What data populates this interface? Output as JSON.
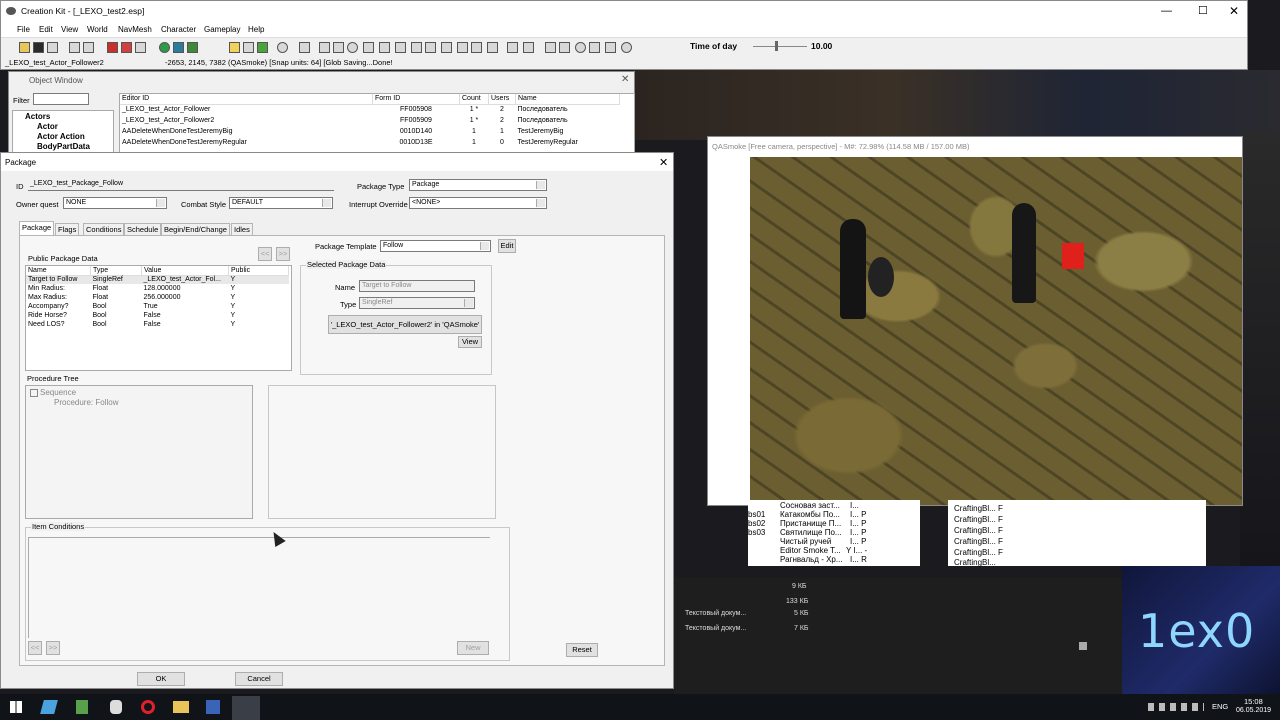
{
  "main_window": {
    "title": "Creation Kit - [_LEXO_test2.esp]",
    "menu": [
      "File",
      "Edit",
      "View",
      "World",
      "NavMesh",
      "Character",
      "Gameplay",
      "Help"
    ],
    "time_of_day_label": "Time of day",
    "time_of_day_value": "10.00",
    "time_of_day_slider": 0.42,
    "status_left": "_LEXO_test_Actor_Follower2",
    "status_right": "-2653, 2145, 7382 (QASmoke) [Snap units: 64] [Glob Saving...Done!"
  },
  "object_window": {
    "title": "Object Window",
    "filter_label": "Filter",
    "tree": [
      "Actors",
      "Actor",
      "Actor Action",
      "BodyPartData"
    ],
    "columns": [
      "Editor ID",
      "Form ID",
      "Count",
      "Users",
      "Name"
    ],
    "rows": [
      {
        "editor_id": "_LEXO_test_Actor_Follower",
        "form_id": "FF005908",
        "count": "1 *",
        "users": "2",
        "name": "Последователь"
      },
      {
        "editor_id": "_LEXO_test_Actor_Follower2",
        "form_id": "FF005909",
        "count": "1 *",
        "users": "2",
        "name": "Последователь"
      },
      {
        "editor_id": "AADeleteWhenDoneTestJeremyBig",
        "form_id": "0010D140",
        "count": "1",
        "users": "1",
        "name": "TestJeremyBig"
      },
      {
        "editor_id": "AADeleteWhenDoneTestJeremyRegular",
        "form_id": "0010D13E",
        "count": "1",
        "users": "0",
        "name": "TestJeremyRegular"
      }
    ]
  },
  "render_window": {
    "title": "QASmoke [Free camera, perspective] - M#: 72.98% (114.58 MB / 157.00 MB)"
  },
  "package_dialog": {
    "title": "Package",
    "id_label": "ID",
    "id_value": "_LEXO_test_Package_Follow",
    "package_type_label": "Package Type",
    "package_type_value": "Package",
    "owner_quest_label": "Owner quest",
    "owner_quest_value": "NONE",
    "combat_style_label": "Combat Style",
    "combat_style_value": "DEFAULT",
    "interrupt_override_label": "Interrupt Override",
    "interrupt_override_value": "<NONE>",
    "tabs": [
      "Package",
      "Flags",
      "Conditions",
      "Schedule",
      "Begin/End/Change",
      "Idles"
    ],
    "public_data_label": "Public Package Data",
    "prev_btn": "<<",
    "next_btn": ">>",
    "data_columns": [
      "Name",
      "Type",
      "Value",
      "Public"
    ],
    "data_rows": [
      {
        "name": "Target to Follow",
        "type": "SingleRef",
        "value": "_LEXO_test_Actor_Fol...",
        "public": "Y"
      },
      {
        "name": "Min Radius:",
        "type": "Float",
        "value": "128.000000",
        "public": "Y"
      },
      {
        "name": "Max Radius:",
        "type": "Float",
        "value": "256.000000",
        "public": "Y"
      },
      {
        "name": "Accompany?",
        "type": "Bool",
        "value": "True",
        "public": "Y"
      },
      {
        "name": "Ride Horse?",
        "type": "Bool",
        "value": "False",
        "public": "Y"
      },
      {
        "name": "Need LOS?",
        "type": "Bool",
        "value": "False",
        "public": "Y"
      }
    ],
    "package_template_label": "Package Template",
    "package_template_value": "Follow",
    "edit_btn": "Edit",
    "selected_group_label": "Selected Package Data",
    "sel_name_label": "Name",
    "sel_name_value": "Target to Follow",
    "sel_type_label": "Type",
    "sel_type_value": "SingleRef",
    "sel_ref_value": "'_LEXO_test_Actor_Follower2' in 'QASmoke'",
    "view_btn": "View",
    "procedure_tree_label": "Procedure Tree",
    "procedure_tree": [
      "Sequence",
      "Procedure: Follow"
    ],
    "item_conditions_label": "Item Conditions",
    "new_btn": "New",
    "reset_btn": "Reset",
    "ok_btn": "OK",
    "cancel_btn": "Cancel"
  },
  "bg_list": {
    "left_rows": [
      "Сосновая заст...",
      "Катакомбы По...",
      "Пристанище П...",
      "Святилище По...",
      "Чистый ручей",
      "Editor Smoke T...",
      "Рагнвальд - Хр..."
    ],
    "left_prefix": [
      "",
      "bs01",
      "bs02",
      "bs03",
      "",
      "",
      ""
    ],
    "right_rows": [
      "CraftingBl...",
      "CraftingBl...",
      "CraftingBl...",
      "CraftingBl...",
      "CraftingBl...",
      "CraftingBl..."
    ]
  },
  "explorer": {
    "sizes": [
      "9 КБ",
      "133 КБ",
      "5 КБ",
      "7 КБ"
    ],
    "docs": [
      "Текстовый докум...",
      "Текстовый докум..."
    ]
  },
  "logo_text": "1ex0",
  "taskbar": {
    "time": "15:08",
    "date": "06.05.2019",
    "lang": "ENG"
  }
}
